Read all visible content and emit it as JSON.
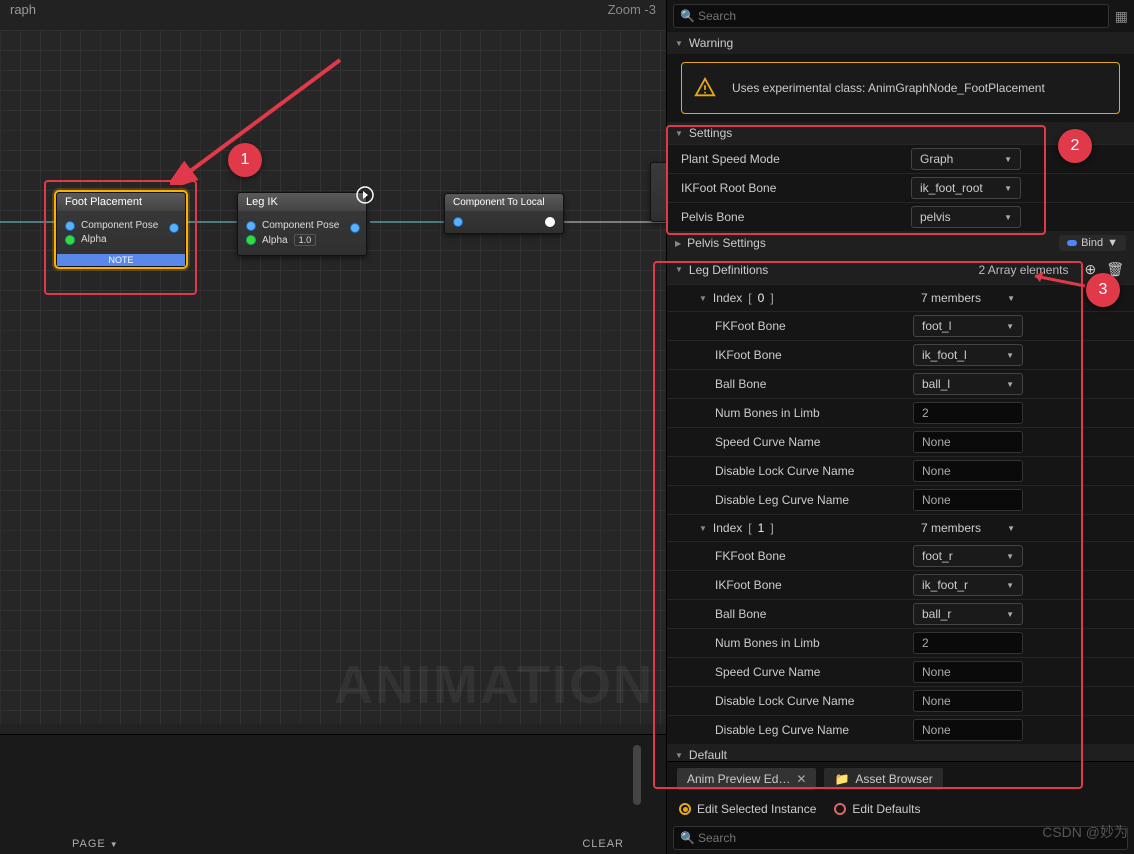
{
  "graph": {
    "title": "raph",
    "zoom": "Zoom  -3",
    "watermark": "ANIMATION",
    "nodes": {
      "foot": {
        "title": "Foot Placement",
        "pose": "Component Pose",
        "alpha": "Alpha",
        "note": "NOTE"
      },
      "legik": {
        "title": "Leg IK",
        "pose": "Component Pose",
        "alpha": "Alpha",
        "alpha_val": "1.0"
      },
      "ctl": {
        "title": "Component To Local"
      }
    }
  },
  "footer": {
    "page": "PAGE",
    "clear": "CLEAR"
  },
  "search": {
    "placeholder": "Search"
  },
  "sections": {
    "warning": "Warning",
    "warning_text": "Uses experimental class: AnimGraphNode_FootPlacement",
    "settings": "Settings",
    "pelvis_settings": "Pelvis Settings",
    "leg_defs": "Leg Definitions",
    "default": "Default"
  },
  "settings": {
    "plant_speed": {
      "label": "Plant Speed Mode",
      "value": "Graph"
    },
    "ik_root": {
      "label": "IKFoot Root Bone",
      "value": "ik_foot_root"
    },
    "pelvis": {
      "label": "Pelvis Bone",
      "value": "pelvis"
    }
  },
  "bind": "Bind",
  "leg": {
    "count": "2 Array elements",
    "index_label": "Index",
    "members": "7 members",
    "indices": [
      "0",
      "1"
    ],
    "props": {
      "fkfoot": "FKFoot Bone",
      "ikfoot": "IKFoot Bone",
      "ball": "Ball Bone",
      "numbones": "Num Bones in Limb",
      "speed": "Speed Curve Name",
      "dlock": "Disable Lock Curve Name",
      "dleg": "Disable Leg Curve Name"
    },
    "data": [
      {
        "fkfoot": "foot_l",
        "ikfoot": "ik_foot_l",
        "ball": "ball_l",
        "numbones": "2",
        "speed": "None",
        "dlock": "None",
        "dleg": "None"
      },
      {
        "fkfoot": "foot_r",
        "ikfoot": "ik_foot_r",
        "ball": "ball_r",
        "numbones": "2",
        "speed": "None",
        "dlock": "None",
        "dleg": "None"
      }
    ]
  },
  "tabs": {
    "preview": "Anim Preview Ed…",
    "browser": "Asset Browser"
  },
  "edit": {
    "selected": "Edit Selected Instance",
    "defaults": "Edit Defaults"
  },
  "csdn": "CSDN @妙为"
}
